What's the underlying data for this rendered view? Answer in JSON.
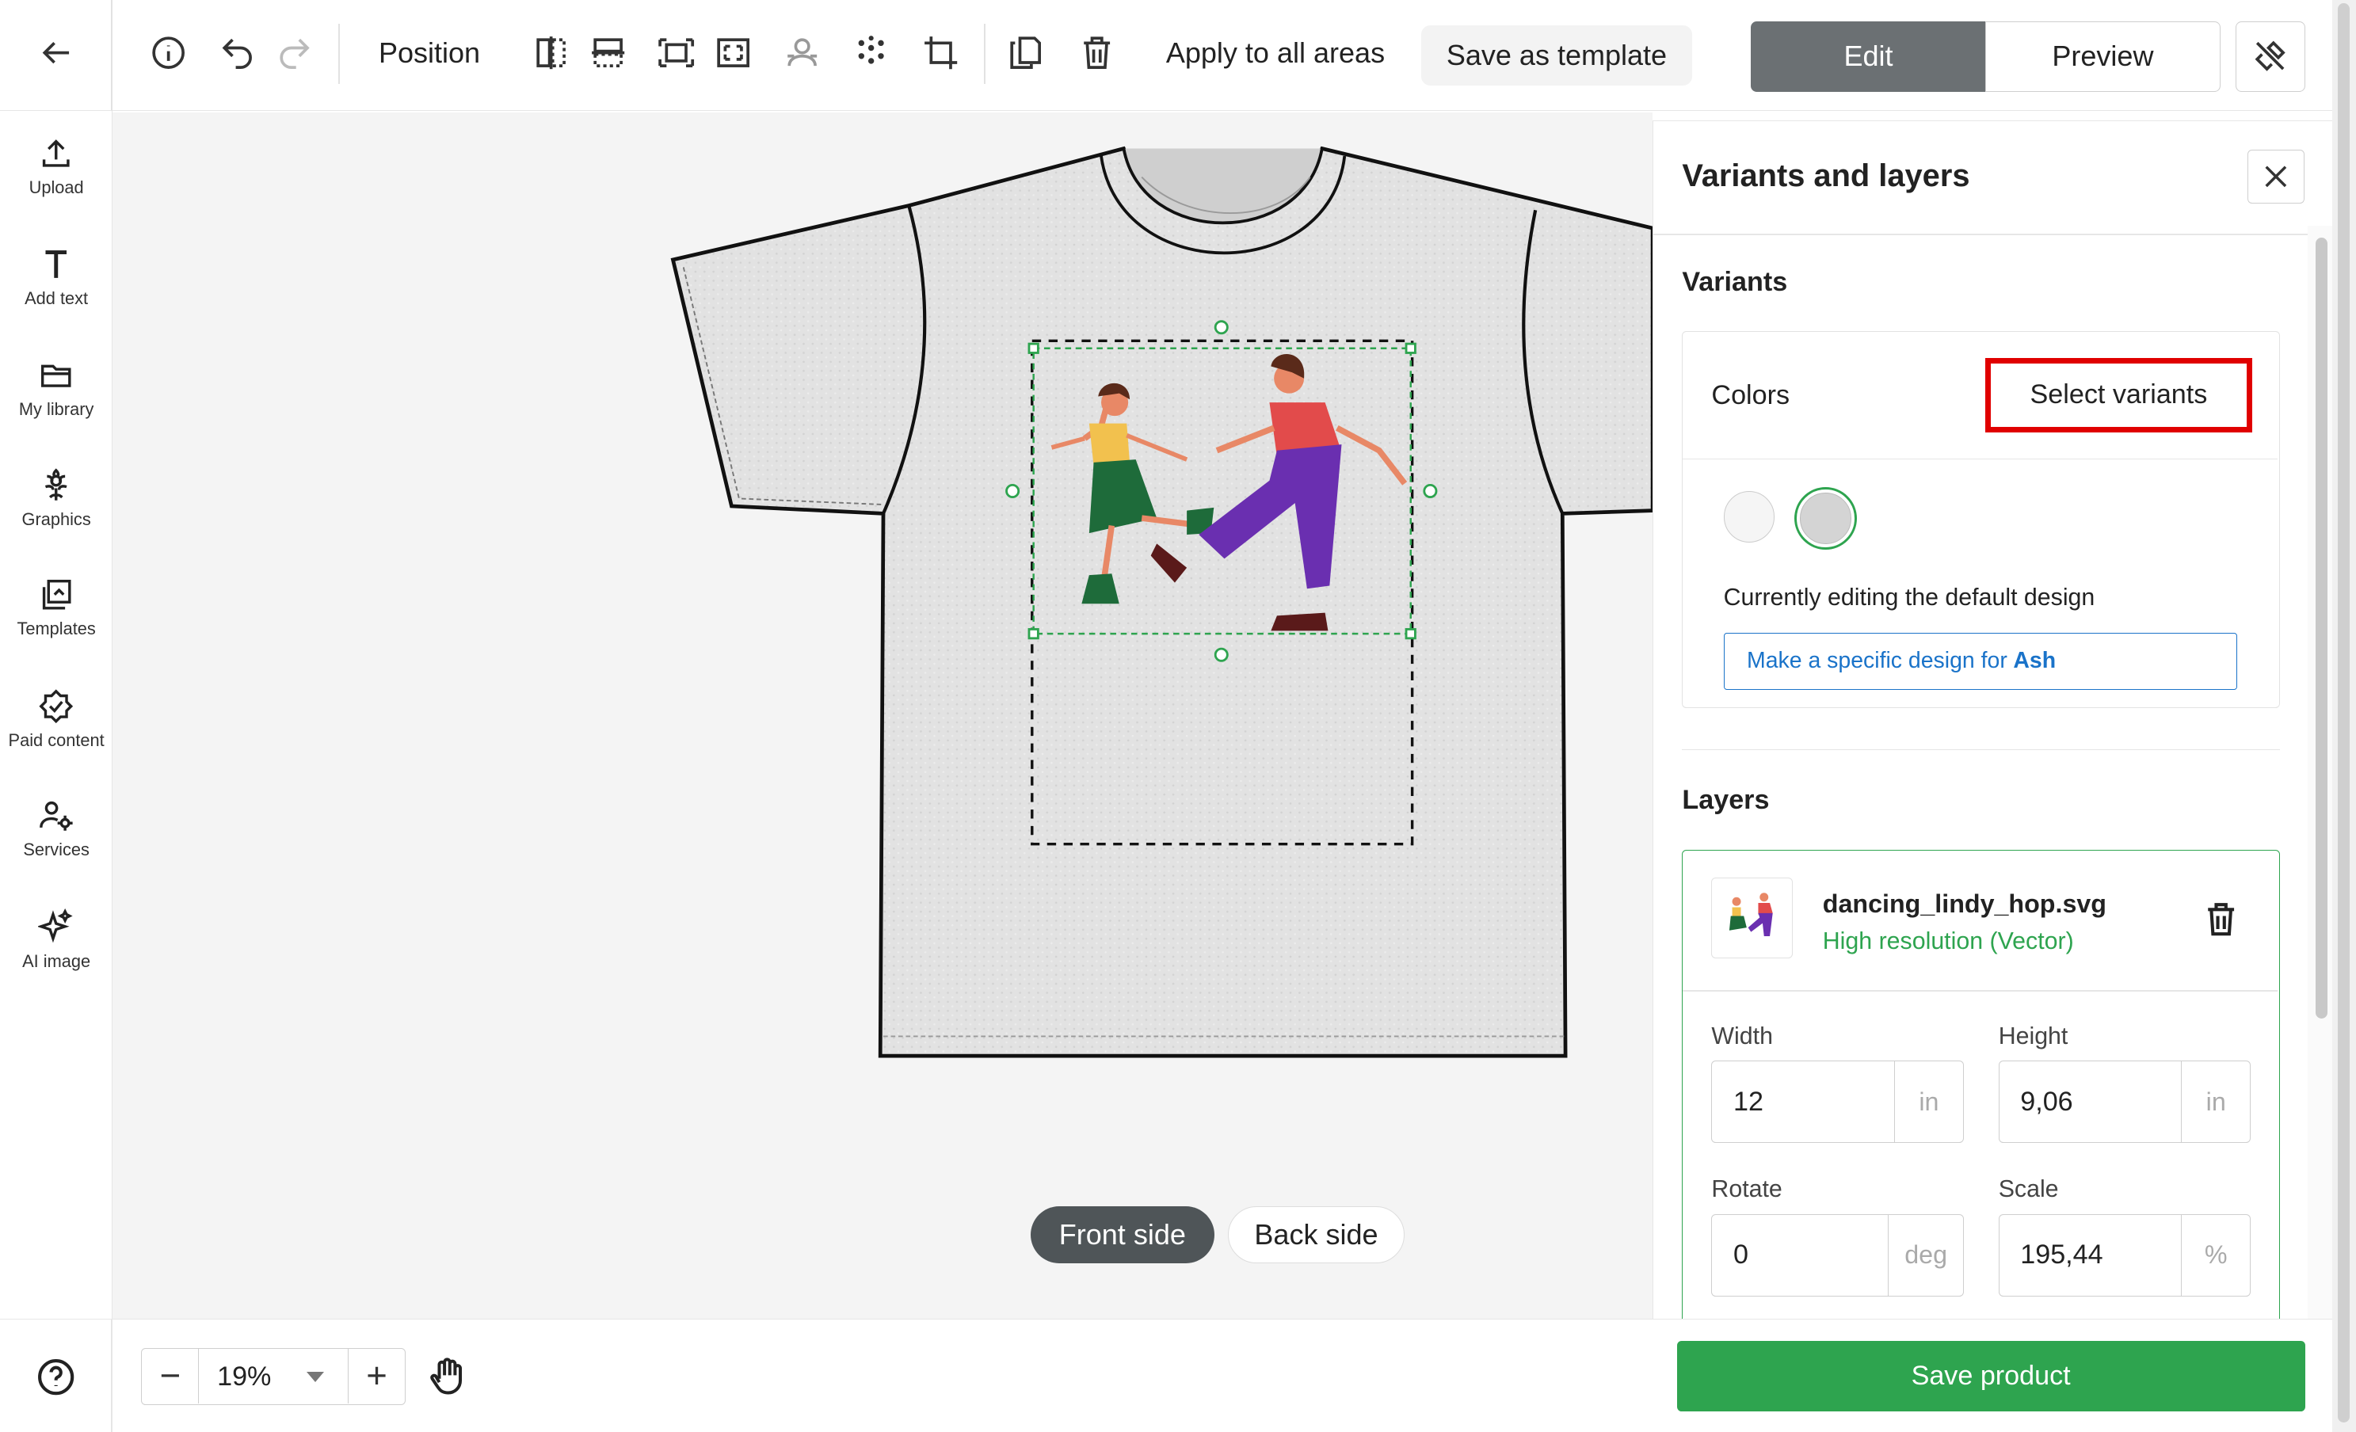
{
  "toolbar": {
    "position_label": "Position",
    "apply_all_label": "Apply to all areas",
    "save_template_label": "Save as template",
    "edit_label": "Edit",
    "preview_label": "Preview",
    "icons": [
      "back-arrow-icon",
      "info-icon",
      "undo-icon",
      "redo-icon",
      "align-vertical-center-icon",
      "align-horizontal-center-icon",
      "fit-to-area-icon",
      "fill-area-icon",
      "remove-background-icon",
      "pattern-icon",
      "crop-icon",
      "duplicate-icon",
      "delete-icon",
      "tools-icon"
    ]
  },
  "sidebar": {
    "items": [
      {
        "label": "Upload",
        "icon": "upload-icon"
      },
      {
        "label": "Add text",
        "icon": "text-icon"
      },
      {
        "label": "My library",
        "icon": "folder-icon"
      },
      {
        "label": "Graphics",
        "icon": "flower-icon"
      },
      {
        "label": "Templates",
        "icon": "templates-icon"
      },
      {
        "label": "Paid content",
        "icon": "badge-check-icon"
      },
      {
        "label": "Services",
        "icon": "services-icon"
      },
      {
        "label": "AI image",
        "icon": "sparkle-icon"
      }
    ],
    "help_icon": "help-icon"
  },
  "canvas": {
    "front_label": "Front side",
    "back_label": "Back side",
    "shirt_color": "#e3e3e3"
  },
  "bottom": {
    "zoom_value": "19%",
    "save_label": "Save product",
    "hand_icon": "hand-pan-icon"
  },
  "panel": {
    "title": "Variants and layers",
    "variants_heading": "Variants",
    "colors_label": "Colors",
    "select_variants_label": "Select variants",
    "editing_default": "Currently editing the default design",
    "specific_design_prefix": "Make a specific design for",
    "specific_design_color": "Ash",
    "layers_heading": "Layers",
    "layer": {
      "name": "dancing_lindy_hop.svg",
      "resolution": "High resolution (Vector)"
    },
    "fields": {
      "width_label": "Width",
      "width_value": "12",
      "width_unit": "in",
      "height_label": "Height",
      "height_value": "9,06",
      "height_unit": "in",
      "rotate_label": "Rotate",
      "rotate_value": "0",
      "rotate_unit": "deg",
      "scale_label": "Scale",
      "scale_value": "195,44",
      "scale_unit": "%"
    }
  },
  "colors": {
    "accent_green": "#2ea44f",
    "edit_bg": "#6b7073",
    "highlight_red": "#e00000",
    "link_blue": "#1a73c9"
  }
}
